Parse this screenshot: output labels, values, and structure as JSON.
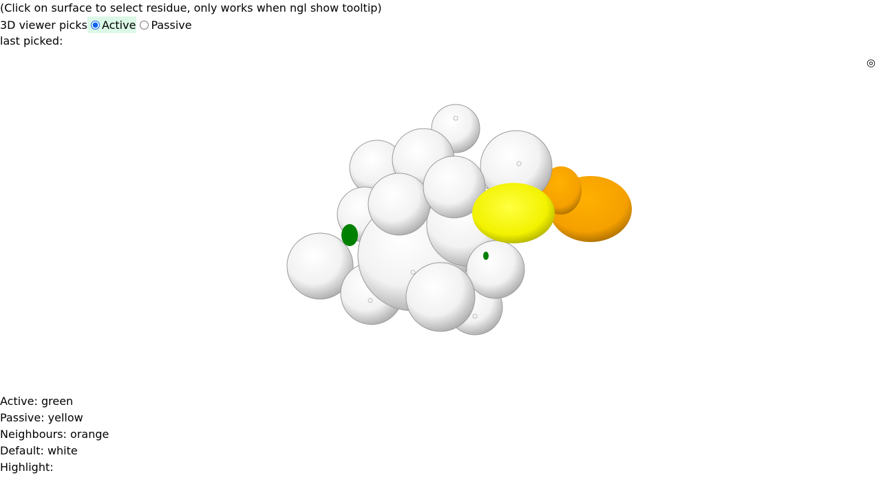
{
  "instructions": "(Click on surface to select residue, only works when ngl show tooltip)",
  "picker": {
    "label": "3D viewer picks",
    "options": [
      {
        "label": "Active",
        "checked": true
      },
      {
        "label": "Passive",
        "checked": false
      }
    ]
  },
  "last_picked": {
    "label": "last picked:",
    "value": ""
  },
  "viewer": {
    "fullscreen_icon": "fullscreen-toggle-icon",
    "colors": {
      "active": "#008000",
      "passive": "#ffff00",
      "neighbours": "#ffa500",
      "default": "#ffffff"
    }
  },
  "legend": {
    "active": "Active: green",
    "passive": "Passive: yellow",
    "neighbours": "Neighbours: orange",
    "default": "Default: white",
    "highlight": "Highlight:"
  }
}
